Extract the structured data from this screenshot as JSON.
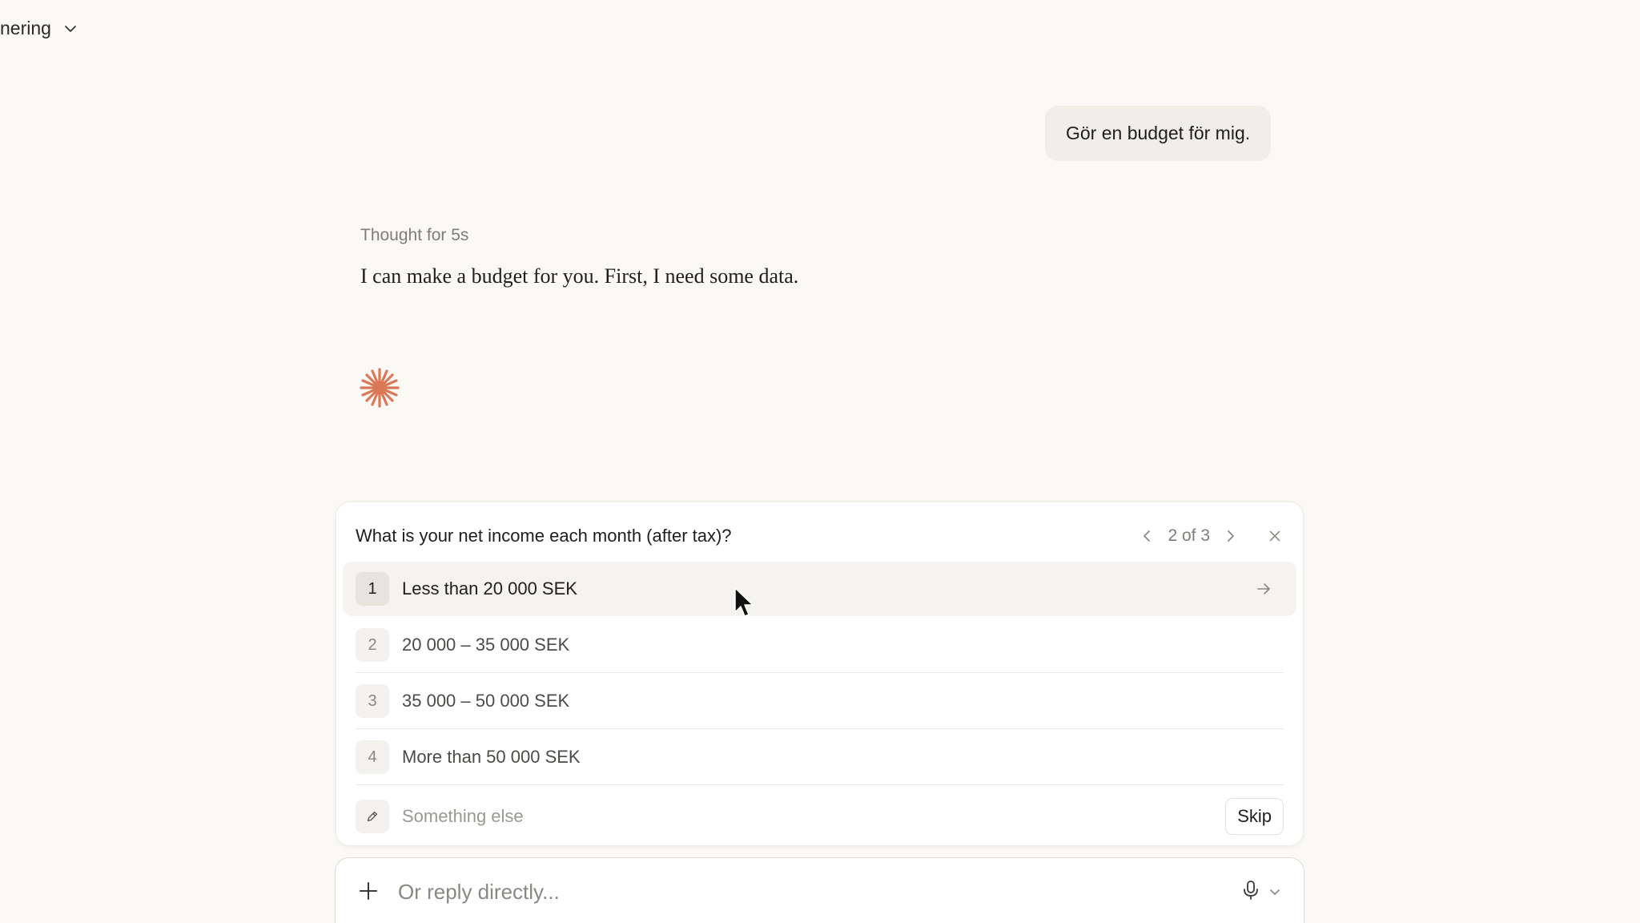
{
  "header": {
    "project_title": "nering"
  },
  "conversation": {
    "user_message": "Gör en budget för mig.",
    "thought_label": "Thought for 5s",
    "assistant_message": "I can make a budget for you. First, I need some data."
  },
  "question_card": {
    "question": "What is your net income each month (after tax)?",
    "pager": "2 of 3",
    "options": [
      {
        "number": "1",
        "label": "Less than 20 000 SEK"
      },
      {
        "number": "2",
        "label": "20 000 – 35 000 SEK"
      },
      {
        "number": "3",
        "label": "35 000 – 50 000 SEK"
      },
      {
        "number": "4",
        "label": "More than 50 000 SEK"
      }
    ],
    "other_placeholder": "Something else",
    "skip_label": "Skip"
  },
  "composer": {
    "placeholder": "Or reply directly..."
  },
  "colors": {
    "accent": "#d97757",
    "background": "#faf9f5"
  }
}
